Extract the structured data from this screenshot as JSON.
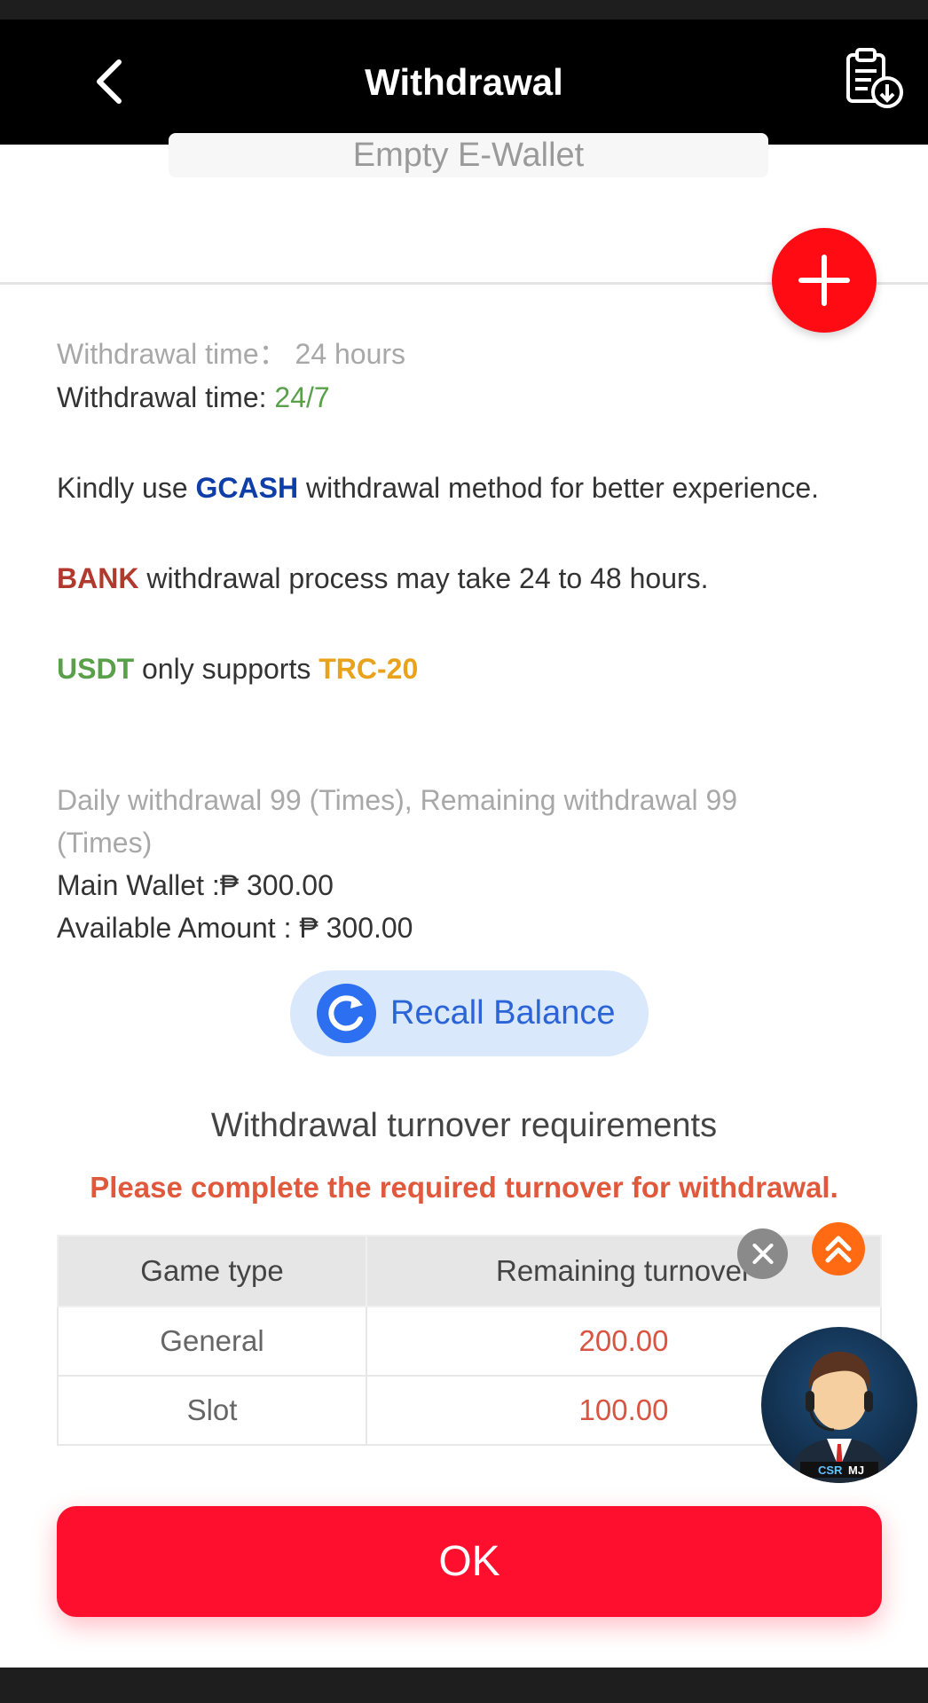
{
  "header": {
    "title": "Withdrawal"
  },
  "wallet": {
    "empty_label": "Empty E-Wallet"
  },
  "notices": {
    "time_label_1": "Withdrawal time：",
    "time_value_1": "24 hours",
    "time_label_2": "Withdrawal time: ",
    "time_value_2": "24/7",
    "gcash_pre": "Kindly use ",
    "gcash_word": "GCASH",
    "gcash_post": " withdrawal method for better experience.",
    "bank_word": "BANK",
    "bank_post": " withdrawal process may take 24 to 48 hours.",
    "usdt_word": "USDT",
    "usdt_mid": " only supports ",
    "usdt_net": "TRC-20"
  },
  "limits": {
    "daily_line1": "Daily withdrawal 99 (Times), Remaining withdrawal 99",
    "daily_line2": "(Times)",
    "main_wallet": "Main Wallet :₱ 300.00",
    "available": "Available Amount : ₱ 300.00"
  },
  "recall": {
    "label": "Recall Balance"
  },
  "turnover": {
    "title": "Withdrawal turnover requirements",
    "warning": "Please complete the required turnover for withdrawal.",
    "columns": [
      "Game type",
      "Remaining turnover"
    ],
    "rows": [
      {
        "type": "General",
        "value": "200.00"
      },
      {
        "type": "Slot",
        "value": "100.00"
      }
    ]
  },
  "csr_badge": {
    "left": "CSR",
    "right": "MJ"
  },
  "ok": {
    "label": "OK"
  },
  "colors": {
    "accent_red": "#ff0f2e",
    "header_bg": "#000000",
    "recall_blue": "#2c6ff0"
  }
}
